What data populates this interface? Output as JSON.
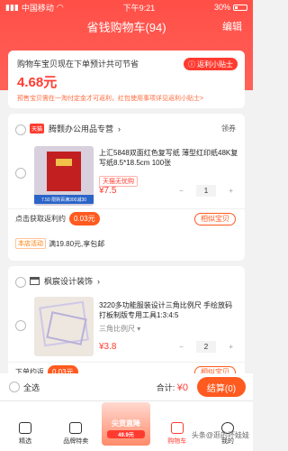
{
  "status": {
    "carrier": "中国移动",
    "time": "下午9:21",
    "battery": "30%"
  },
  "nav": {
    "title": "省钱购物车(94)",
    "edit": "编辑"
  },
  "savings": {
    "label": "购物车宝贝现在下单预计共可节省",
    "amount": "4.68元",
    "note": "预售宝贝需在一淘付定金才可返利，红包使用事项详见返利小贴士>",
    "tips_button": "返利小贴士"
  },
  "shops": [
    {
      "badge": "天猫",
      "name": "腾颢办公用品专营",
      "coupon": "领券",
      "item_title": "上汇5848双面红色复写纸 薄型红印纸48K复写纸8.5*18.5cm 100张",
      "tag": "天猫无忧购",
      "price": "¥7.5",
      "qty": "1",
      "thumb_ribbon": "7.50 限购百满300减30",
      "promo_label": "点击获取返利约",
      "promo_amount": "0.03元",
      "similar": "相似宝贝",
      "activity_badge": "本店活动",
      "activity_text": "满19.80元,享包邮"
    },
    {
      "name": "枫宸设计装饰",
      "item_title": "3220多功能服装设计三角比例尺 手绘放码打板制版专用工具1:3:4:5",
      "variant": "三角比例尺",
      "price": "¥3.8",
      "qty": "2",
      "promo_label": "下单约返",
      "promo_amount": "0.03元",
      "similar": "相似宝贝"
    }
  ],
  "checkout": {
    "select_all": "全选",
    "total_label": "合计:",
    "total": "¥0",
    "pay": "结算(0)"
  },
  "tabbar": {
    "tabs": [
      "精选",
      "品牌特卖",
      "",
      "购物车",
      "我的"
    ],
    "live_title": "尖货直降",
    "live_sub": "49.9元"
  },
  "watermark": "头条@逛的坏娃娃"
}
